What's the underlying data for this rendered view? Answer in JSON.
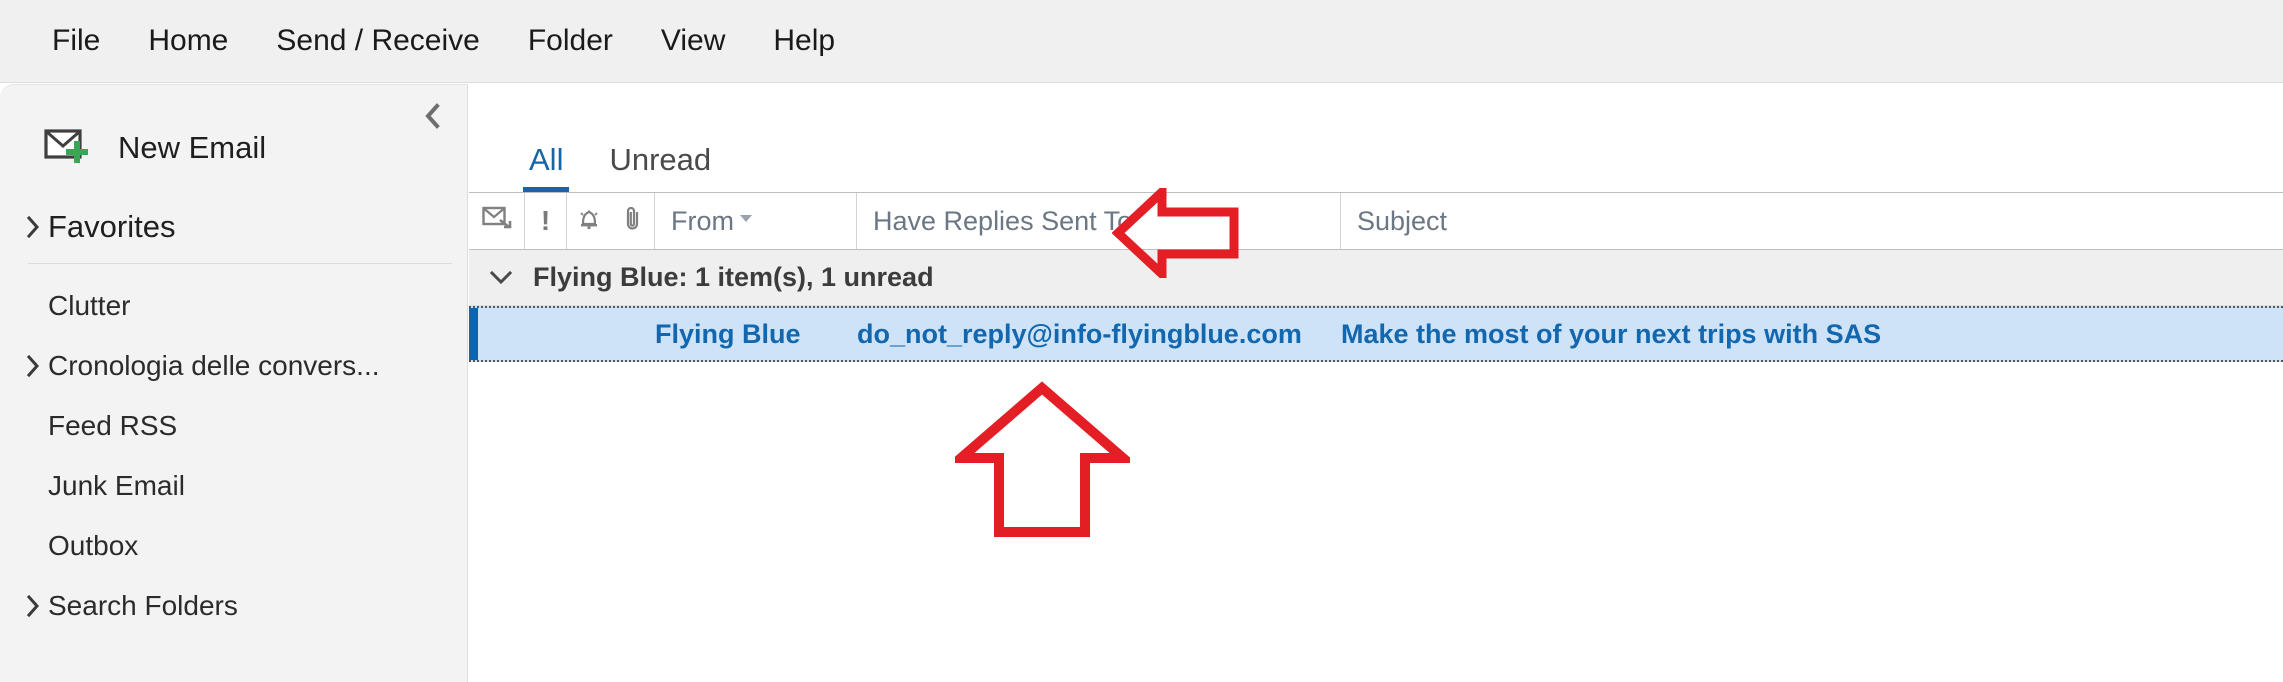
{
  "ribbon": {
    "tabs": [
      {
        "label": "File"
      },
      {
        "label": "Home"
      },
      {
        "label": "Send / Receive"
      },
      {
        "label": "Folder"
      },
      {
        "label": "View"
      },
      {
        "label": "Help"
      }
    ]
  },
  "sidebar": {
    "collapse_icon": "chevron-left-icon",
    "new_email": {
      "label": "New Email",
      "icon": "new-email-envelope-icon",
      "accent_color": "#3aa655"
    },
    "favorites": {
      "label": "Favorites",
      "icon": "chevron-right-icon",
      "expandable": true
    },
    "folders": [
      {
        "label": "Clutter",
        "expandable": false
      },
      {
        "label": "Cronologia delle convers...",
        "expandable": true
      },
      {
        "label": "Feed RSS",
        "expandable": false
      },
      {
        "label": "Junk Email",
        "expandable": false
      },
      {
        "label": "Outbox",
        "expandable": false
      },
      {
        "label": "Search Folders",
        "expandable": true
      }
    ]
  },
  "maillist": {
    "filter_tabs": [
      {
        "label": "All",
        "active": true
      },
      {
        "label": "Unread",
        "active": false
      }
    ],
    "columns": [
      {
        "name": "read-status",
        "label": "",
        "icon": "envelope-read-icon"
      },
      {
        "name": "importance",
        "label": "!",
        "icon": "importance-icon"
      },
      {
        "name": "reminder",
        "label": "",
        "icon": "bell-icon"
      },
      {
        "name": "attachment",
        "label": "",
        "icon": "paperclip-icon"
      },
      {
        "name": "from",
        "label": "From",
        "sort": "descending"
      },
      {
        "name": "have-replies-sent-to",
        "label": "Have Replies Sent To"
      },
      {
        "name": "subject",
        "label": "Subject"
      }
    ],
    "group": {
      "label": "Flying Blue: 1 item(s), 1 unread",
      "icon": "chevron-down-icon",
      "expanded": true
    },
    "rows": [
      {
        "from": "Flying Blue",
        "have_replies_sent_to": "do_not_reply@info-flyingblue.com",
        "subject": "Make the most of your next trips with SAS",
        "selected": true,
        "unread": true
      }
    ]
  },
  "annotations": {
    "arrows": [
      {
        "name": "arrow-pointing-to-have-replies-sent-to-column",
        "direction": "left",
        "color": "#E31E24"
      },
      {
        "name": "arrow-pointing-to-message-row",
        "direction": "up",
        "color": "#E31E24"
      }
    ]
  },
  "colors": {
    "accent_blue": "#1565a8",
    "selected_row_bg": "#cee3f7",
    "selection_bar": "#0f64ae",
    "row_text": "#1267ae",
    "group_header_bg": "#efefef",
    "sidebar_bg": "#f3f3f3",
    "ribbon_bg": "#f0f0f0",
    "annotation_red": "#E31E24"
  }
}
